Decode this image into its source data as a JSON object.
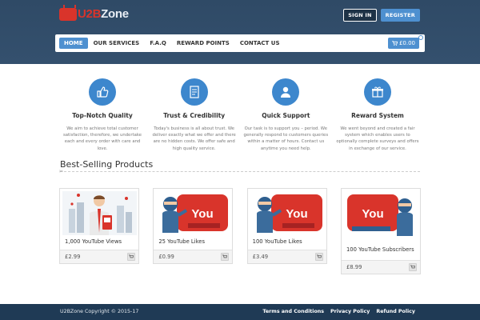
{
  "brand": {
    "logo_mark": "U2B",
    "logo_u2b": "U2B",
    "logo_zone": "Zone"
  },
  "auth": {
    "sign_in": "SIGN IN",
    "register": "REGISTER"
  },
  "nav": {
    "items": [
      "HOME",
      "OUR SERVICES",
      "F.A.Q",
      "REWARD POINTS",
      "CONTACT US"
    ],
    "cart_label": "🛒 £0.00"
  },
  "features": [
    {
      "icon": "thumbs-up-icon",
      "title": "Top-Notch Quality",
      "desc": "We aim to achieve total customer satisfaction, therefore, we undertake each and every order with care and love."
    },
    {
      "icon": "document-icon",
      "title": "Trust & Credibility",
      "desc": "Today's business is all about trust. We deliver exactly what we offer and there are no hidden costs. We offer safe and high quality service."
    },
    {
      "icon": "user-icon",
      "title": "Quick Support",
      "desc": "Our task is to support you – period. We generally respond to customers queries within a matter of hours. Contact us anytime you need help."
    },
    {
      "icon": "gift-icon",
      "title": "Reward System",
      "desc": "We went beyond and created a fair system which enables users to optionally complete surveys and offers in exchange of our service."
    }
  ],
  "section": {
    "title": "Best-Selling Products"
  },
  "products": [
    {
      "name": "1,000 YouTube Views",
      "price": "£2.99"
    },
    {
      "name": "25 YouTube Likes",
      "price": "£0.99"
    },
    {
      "name": "100 YouTube Likes",
      "price": "£3.49"
    },
    {
      "name": "100 YouTube Subscribers",
      "price": "£8.99"
    }
  ],
  "footer": {
    "copyright": "U2BZone Copyright © 2015-17",
    "links": [
      "Terms and Conditions",
      "Privacy Policy",
      "Refund Policy"
    ]
  },
  "colors": {
    "header": "#34506e",
    "accent": "#4e90d0",
    "footer": "#1f3a55",
    "youtube_red": "#d9342b"
  }
}
